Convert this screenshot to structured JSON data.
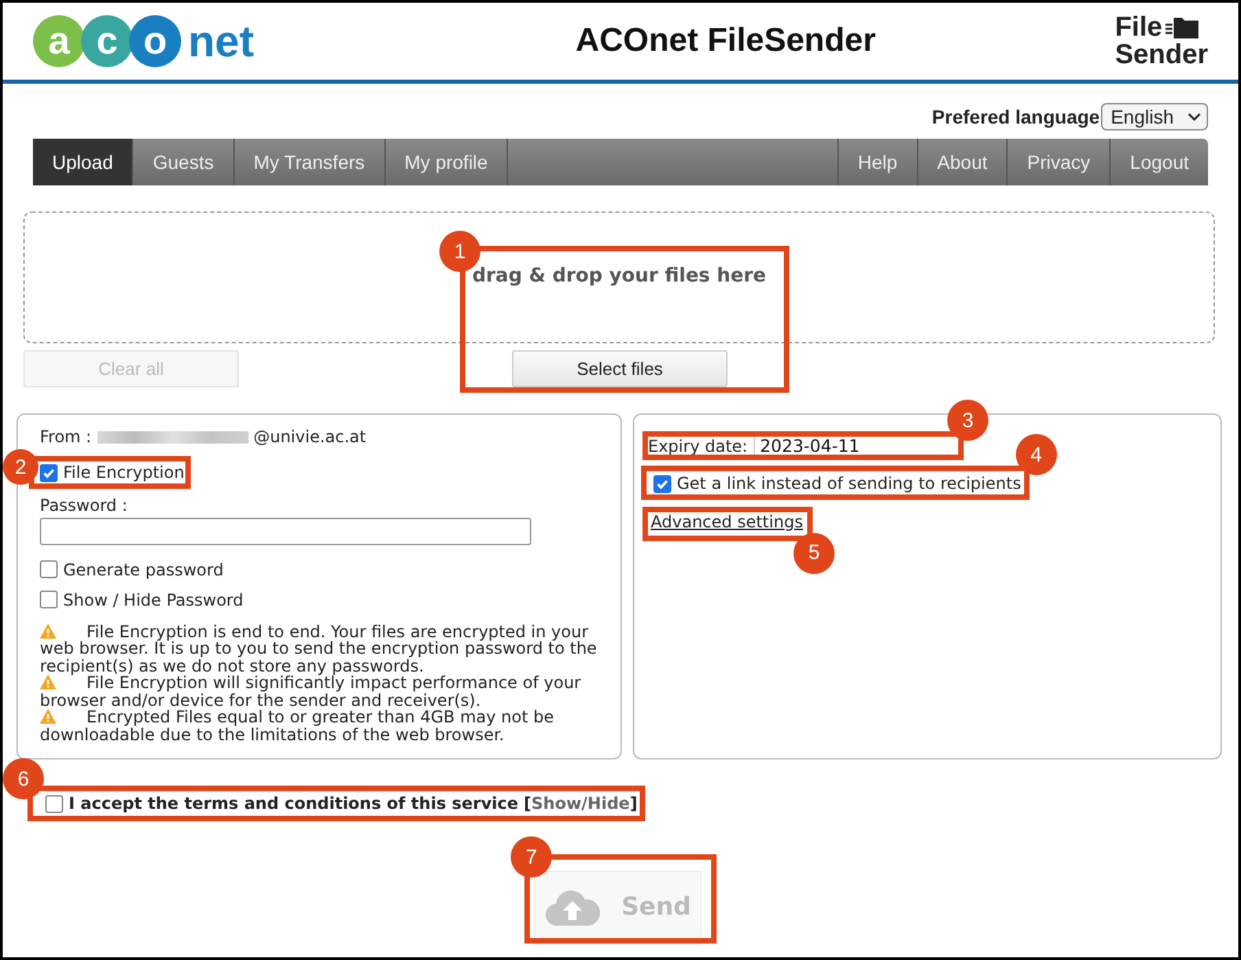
{
  "header": {
    "logo": {
      "letters": [
        "a",
        "c",
        "o"
      ],
      "word": "net"
    },
    "title": "ACOnet FileSender",
    "brand": [
      "File",
      "Sender"
    ]
  },
  "language": {
    "label": "Prefered language",
    "value": "English"
  },
  "nav": {
    "left": [
      {
        "label": "Upload",
        "selected": true
      },
      {
        "label": "Guests",
        "selected": false
      },
      {
        "label": "My Transfers",
        "selected": false
      },
      {
        "label": "My profile",
        "selected": false
      }
    ],
    "right": [
      {
        "label": "Help",
        "selected": false
      },
      {
        "label": "About",
        "selected": false
      },
      {
        "label": "Privacy",
        "selected": false
      },
      {
        "label": "Logout",
        "selected": false
      }
    ]
  },
  "dropzone": {
    "text": "drag & drop your files here",
    "clear_button": {
      "label": "Clear all",
      "disabled": true
    },
    "select_button": {
      "label": "Select files",
      "disabled": false
    }
  },
  "left_panel": {
    "from_label": "From :",
    "from_domain": "@univie.ac.at",
    "encryption": {
      "label": "File Encryption",
      "checked": true
    },
    "password": {
      "label": "Password :"
    },
    "options": [
      {
        "label": "Generate password",
        "checked": false
      },
      {
        "label": "Show / Hide Password",
        "checked": false
      }
    ],
    "warnings": [
      "File Encryption is end to end. Your files are encrypted in your web browser. It is up to you to send the encryption password to the recipient(s) as we do not store any passwords.",
      "File Encryption will significantly impact performance of your browser and/or device for the sender and receiver(s).",
      "Encrypted Files equal to or greater than 4GB may not be downloadable due to the limitations of the web browser."
    ]
  },
  "right_panel": {
    "expiry_label": "Expiry date:",
    "expiry_value": "2023-04-11",
    "get_link": {
      "label": "Get a link instead of sending to recipients",
      "checked": true
    },
    "advanced": "Advanced settings"
  },
  "terms": {
    "label": "I accept the terms and conditions of this service",
    "link_open": "[",
    "link": "Show/Hide",
    "link_close": "]",
    "checked": false
  },
  "send": {
    "label": "Send",
    "disabled": true
  },
  "callouts": [
    {
      "number": "1"
    },
    {
      "number": "2"
    },
    {
      "number": "3"
    },
    {
      "number": "4"
    },
    {
      "number": "5"
    },
    {
      "number": "6"
    },
    {
      "number": "7"
    }
  ]
}
